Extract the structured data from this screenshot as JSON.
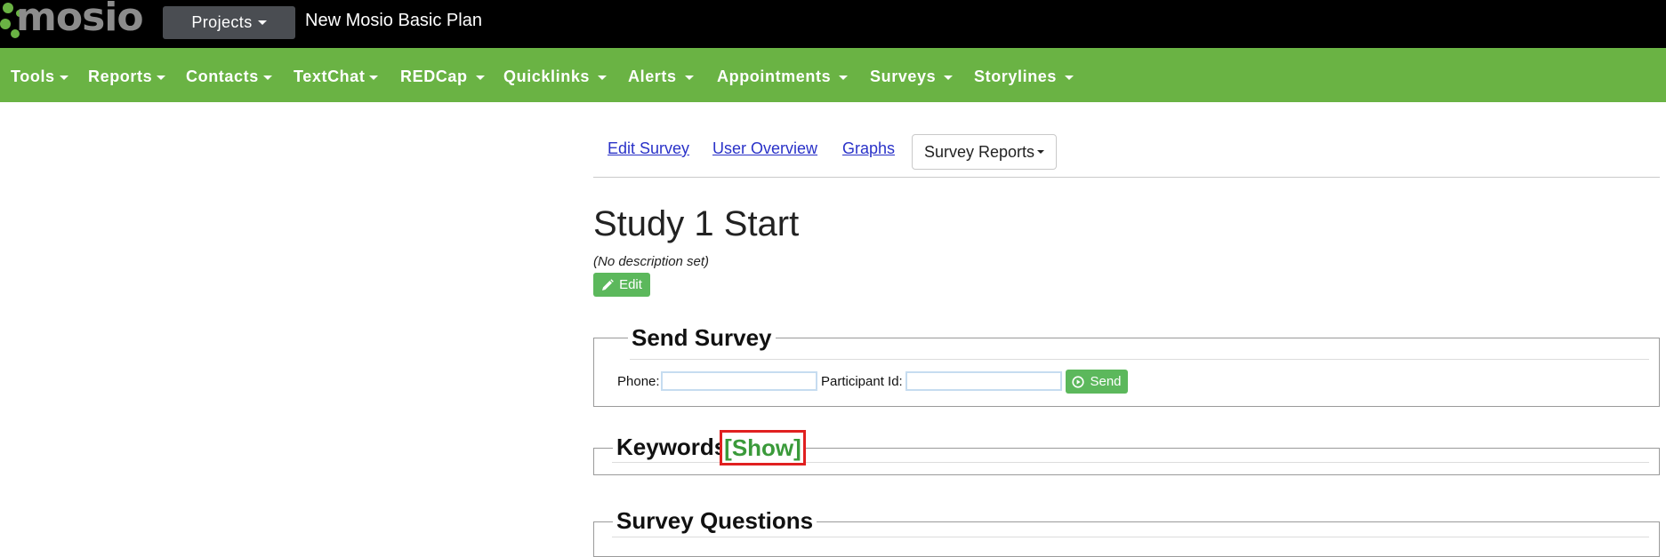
{
  "header": {
    "logo_text": "mosio",
    "projects_label": "Projects",
    "plan_name": "New Mosio Basic Plan"
  },
  "nav": {
    "items": [
      {
        "label": "Tools"
      },
      {
        "label": "Reports"
      },
      {
        "label": "Contacts"
      },
      {
        "label": "TextChat"
      },
      {
        "label": "REDCap"
      },
      {
        "label": "Quicklinks"
      },
      {
        "label": "Alerts"
      },
      {
        "label": "Appointments"
      },
      {
        "label": "Surveys"
      },
      {
        "label": "Storylines"
      }
    ]
  },
  "subtabs": {
    "edit_survey": "Edit Survey",
    "user_overview": "User Overview",
    "graphs": "Graphs",
    "survey_reports": "Survey Reports"
  },
  "survey": {
    "title": "Study 1 Start",
    "description": "(No description set)",
    "edit_label": "Edit"
  },
  "send_survey": {
    "legend": "Send Survey",
    "phone_label": "Phone:",
    "phone_value": "",
    "participant_label": "Participant Id:",
    "participant_value": "",
    "send_label": "Send"
  },
  "keywords": {
    "legend": "Keywords",
    "show_label": "[Show]"
  },
  "survey_questions": {
    "legend": "Survey Questions"
  },
  "colors": {
    "nav_green": "#6ab344",
    "button_green": "#5cb85c",
    "link_blue": "#2a32c8",
    "highlight_red": "#e02020"
  }
}
